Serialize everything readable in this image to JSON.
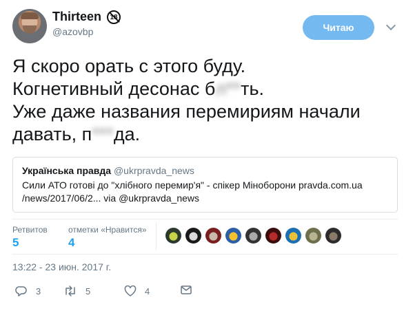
{
  "author": {
    "name": "Thirteen",
    "badge": "18",
    "handle": "@azovbp"
  },
  "follow_button": "Читаю",
  "tweet_lines": {
    "line1": "Я скоро орать с этого буду.",
    "line2_pre": "Когнетивный десонас б",
    "line2_blur": "л**",
    "line2_post": "ть.",
    "line3": "Уже даже названия перемириям начали",
    "line4_pre": "давать, п",
    "line4_blur": "***",
    "line4_post": "да."
  },
  "quote": {
    "source_name": "Українська правда",
    "source_handle": "@ukrpravda_news",
    "text": "Сили АТО готові до \"хлібного перемир'я\" - спікер Міноборони pravda.com.ua /news/2017/06/2... via @ukrpravda_news"
  },
  "stats": {
    "retweets_label": "Ретвитов",
    "retweets_value": "5",
    "likes_label": "отметки «Нравится»",
    "likes_value": "4"
  },
  "liker_avatars": [
    {
      "colors": [
        "#2b3a2d",
        "#c7d44a"
      ]
    },
    {
      "colors": [
        "#1a1a1a",
        "#d9d9d9"
      ]
    },
    {
      "colors": [
        "#7a1f1f",
        "#c9b9a8"
      ]
    },
    {
      "colors": [
        "#2d5fa8",
        "#f2c230"
      ]
    },
    {
      "colors": [
        "#333333",
        "#aaaaaa"
      ]
    },
    {
      "colors": [
        "#3b0d0d",
        "#b52a2a"
      ]
    },
    {
      "colors": [
        "#1c6fb3",
        "#e9c23a"
      ]
    },
    {
      "colors": [
        "#6d6f4b",
        "#b8b391"
      ]
    },
    {
      "colors": [
        "#2c2c2c",
        "#8a7a6a"
      ]
    }
  ],
  "timestamp": "13:22 - 23 июн. 2017 г.",
  "actions": {
    "reply_count": "3",
    "retweet_count": "5",
    "like_count": "4"
  },
  "colors": {
    "accent": "#1da1f2",
    "follow_bg": "#74b9f0",
    "muted": "#657786"
  }
}
